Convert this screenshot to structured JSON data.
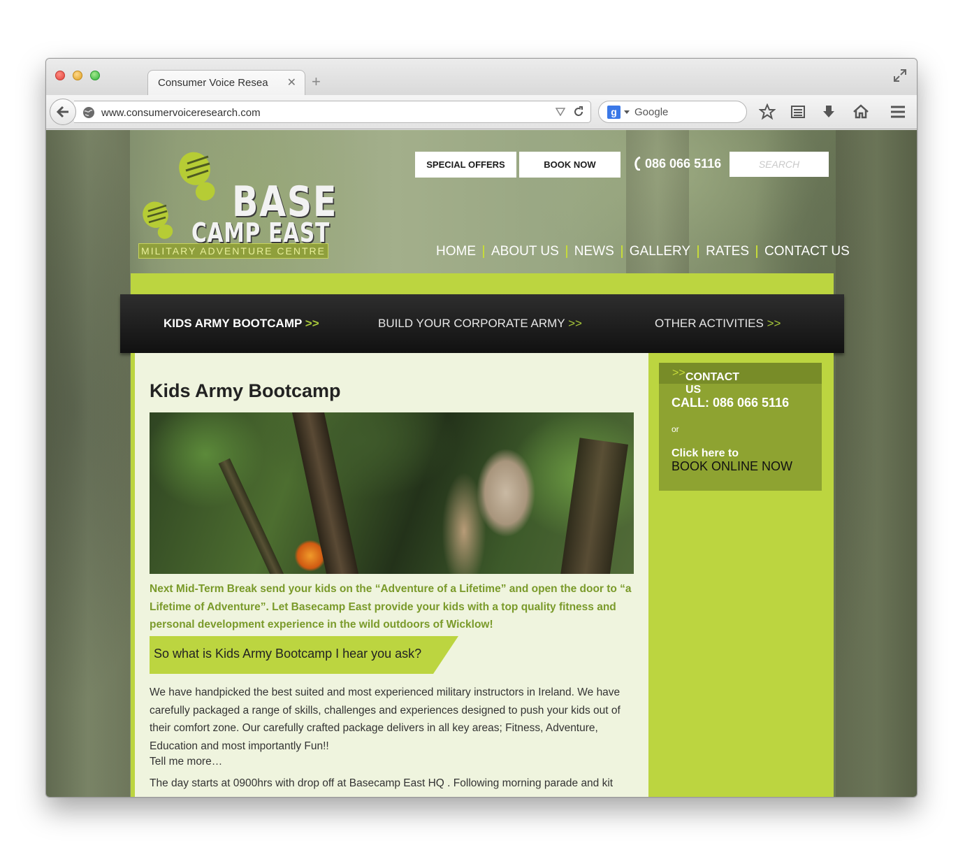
{
  "browser": {
    "tab_title": "Consumer Voice Resea",
    "url": "www.consumervoiceresearch.com",
    "search_engine_placeholder": "Google",
    "search_engine_icon_letter": "g"
  },
  "site": {
    "logo": {
      "line1": "BASE",
      "line2": "CAMP EAST",
      "tagline": "MILITARY ADVENTURE CENTRE"
    },
    "top_buttons": {
      "special_offers": "SPECIAL OFFERS",
      "book_now": "BOOK NOW"
    },
    "phone": "086 066 5116",
    "search_placeholder": "SEARCH",
    "nav": [
      "HOME",
      "ABOUT US",
      "NEWS",
      "GALLERY",
      "RATES",
      "CONTACT US"
    ],
    "categories": [
      {
        "label": "KIDS ARMY BOOTCAMP",
        "arrows": ">>"
      },
      {
        "label": "BUILD YOUR CORPORATE ARMY",
        "arrows": ">>"
      },
      {
        "label": "OTHER ACTIVITIES",
        "arrows": ">>"
      }
    ],
    "accent_green": "#bcd540",
    "dark_green": "#8ea331"
  },
  "main": {
    "title": "Kids Army Bootcamp",
    "intro": "Next Mid-Term Break send your kids on the “Adventure of a Lifetime” and open the door to “a Lifetime of Adventure”. Let Basecamp East provide your kids with a top quality fitness and personal development experience in the wild outdoors of Wicklow!",
    "ribbon": "So what is Kids Army Bootcamp I hear you ask?",
    "body": "We have handpicked the best suited and most experienced military instructors in Ireland. We have carefully packaged a range of skills, challenges and experiences designed to push your kids out of their comfort zone. Our carefully crafted package delivers in all key areas; Fitness, Adventure, Education and most importantly Fun!!",
    "tell_more": "Tell me more…",
    "day_start": "The day starts at 0900hrs with drop off at Basecamp East HQ . Following morning parade and kit"
  },
  "sidebar": {
    "heading": "CONTACT US",
    "heading_arrows": ">>",
    "call": "CALL: 086 066 5116",
    "or": "or",
    "click_here": "Click here  to",
    "book_online": "BOOK ONLINE NOW"
  }
}
